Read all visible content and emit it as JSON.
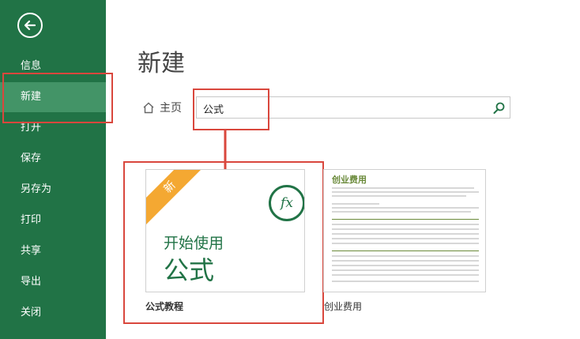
{
  "sidebar": {
    "items": [
      {
        "label": "信息"
      },
      {
        "label": "新建"
      },
      {
        "label": "打开"
      },
      {
        "label": "保存"
      },
      {
        "label": "另存为"
      },
      {
        "label": "打印"
      },
      {
        "label": "共享"
      },
      {
        "label": "导出"
      },
      {
        "label": "关闭"
      }
    ]
  },
  "main": {
    "title": "新建",
    "breadcrumb_home": "主页",
    "search": {
      "value": "公式"
    },
    "templates": [
      {
        "badge": "新",
        "icon_text": "fx",
        "line1": "开始使用",
        "line2": "公式",
        "caption": "公式教程"
      },
      {
        "preview_title": "创业费用",
        "caption": "创业费用"
      }
    ]
  },
  "colors": {
    "sidebar": "#217346",
    "active_item": "#439467",
    "accent": "#217346",
    "ribbon": "#f4a832",
    "annotation": "#d9473d"
  }
}
